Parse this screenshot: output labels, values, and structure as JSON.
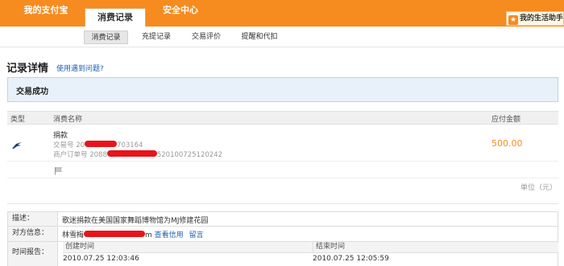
{
  "topnav": {
    "tabs": [
      {
        "label": "我的支付宝"
      },
      {
        "label": "消费记录"
      },
      {
        "label": "安全中心"
      }
    ],
    "life_assistant": "我的生活助手"
  },
  "subnav": {
    "items": [
      {
        "label": "消费记录"
      },
      {
        "label": "充提记录"
      },
      {
        "label": "交易评价"
      },
      {
        "label": "提醒和代扣"
      }
    ]
  },
  "page": {
    "title": "记录详情",
    "help_link": "使用遇到问题?"
  },
  "status": "交易成功",
  "table": {
    "headers": {
      "type": "类型",
      "name": "消费名称",
      "amount": "应付金额"
    },
    "row": {
      "type_icon": "alipay-swallow-icon",
      "name": "捐款",
      "trade_label": "交易号",
      "trade_no_start": "20",
      "trade_no_end": "703164",
      "order_label": "商户订单号",
      "order_no_start": "2088",
      "order_no_end": "520100725120242",
      "amount": "500.00"
    },
    "flag_icon": "flag-icon",
    "unit": "单位（元）"
  },
  "details": {
    "desc_label": "描述：",
    "desc_value": "歌迷捐款在美国国家舞蹈博物馆为MJ修建花园",
    "party_label": "对方信息：",
    "party_name_start": "林雪梅",
    "party_name_end": "m",
    "credit_link": "查看信用",
    "message_link": "留言",
    "time_label": "时间报告：",
    "created_label": "创建时间",
    "created_value": "2010.07.25 12:03:46",
    "ended_label": "结束时间",
    "ended_value": "2010.07.25 12:05:59"
  },
  "colors": {
    "brand_orange": "#f68b1f",
    "redaction": "#e8141b",
    "link": "#1a5fb4"
  }
}
